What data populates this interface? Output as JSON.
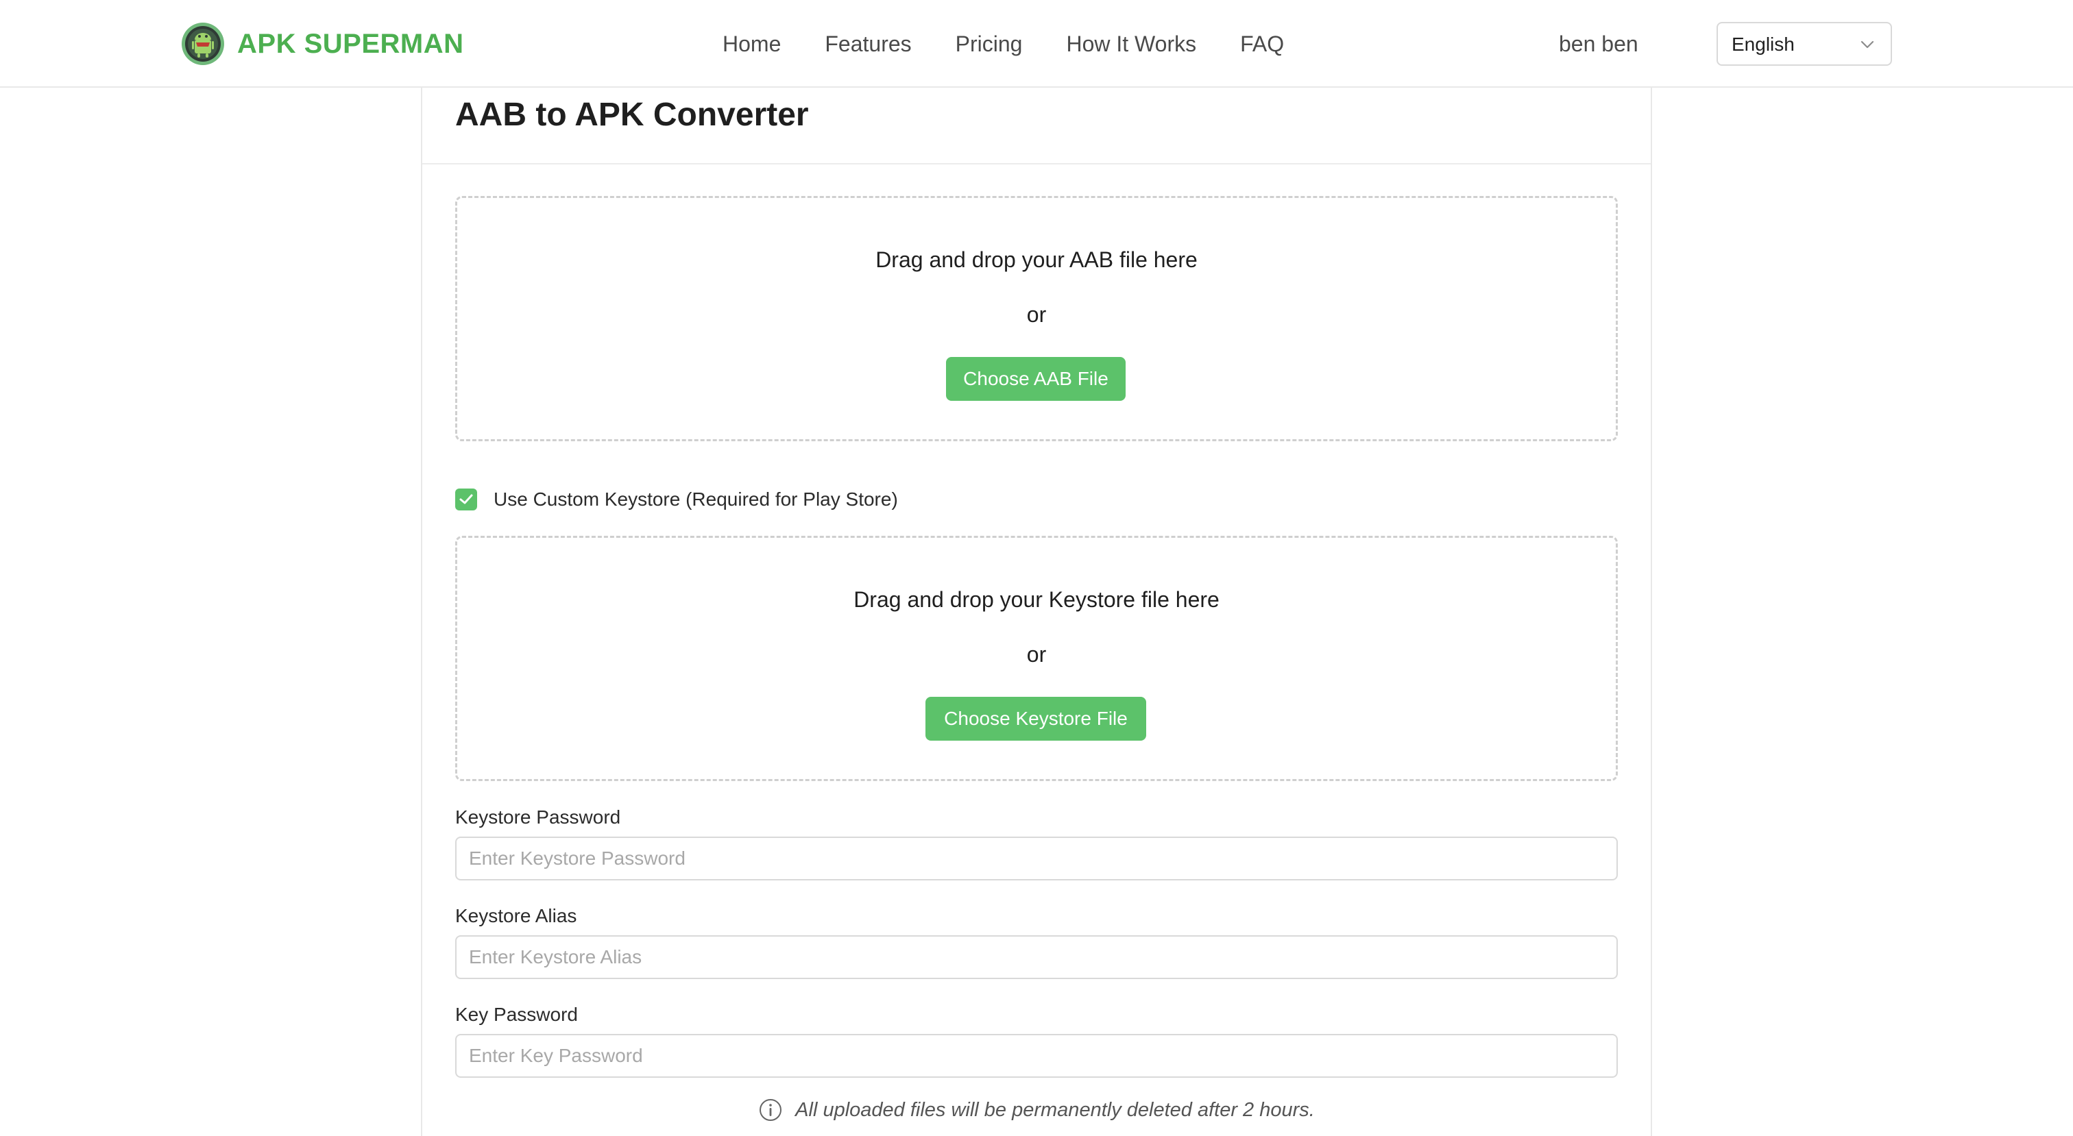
{
  "header": {
    "brand": "APK SUPERMAN",
    "nav": [
      "Home",
      "Features",
      "Pricing",
      "How It Works",
      "FAQ"
    ],
    "user": "ben ben",
    "language": "English"
  },
  "main": {
    "title": "AAB to APK Converter",
    "aab_upload": {
      "prompt": "Drag and drop your AAB file here",
      "or": "or",
      "button": "Choose AAB File"
    },
    "custom_keystore": {
      "label": "Use Custom Keystore (Required for Play Store)",
      "checked": true
    },
    "keystore_upload": {
      "prompt": "Drag and drop your Keystore file here",
      "or": "or",
      "button": "Choose Keystore File"
    },
    "fields": [
      {
        "label": "Keystore Password",
        "placeholder": "Enter Keystore Password",
        "value": ""
      },
      {
        "label": "Keystore Alias",
        "placeholder": "Enter Keystore Alias",
        "value": ""
      },
      {
        "label": "Key Password",
        "placeholder": "Enter Key Password",
        "value": ""
      }
    ],
    "notice": "All uploaded files will be permanently deleted after 2 hours."
  },
  "icons": {
    "logo": "android-robot-logo-icon",
    "language_dropdown": "chevron-down-icon",
    "checkbox": "checkmark-icon",
    "notice": "info-circle-icon"
  },
  "colors": {
    "brand_green": "#4caf50",
    "button_green": "#5cc26a",
    "border": "#d9d9d9"
  }
}
